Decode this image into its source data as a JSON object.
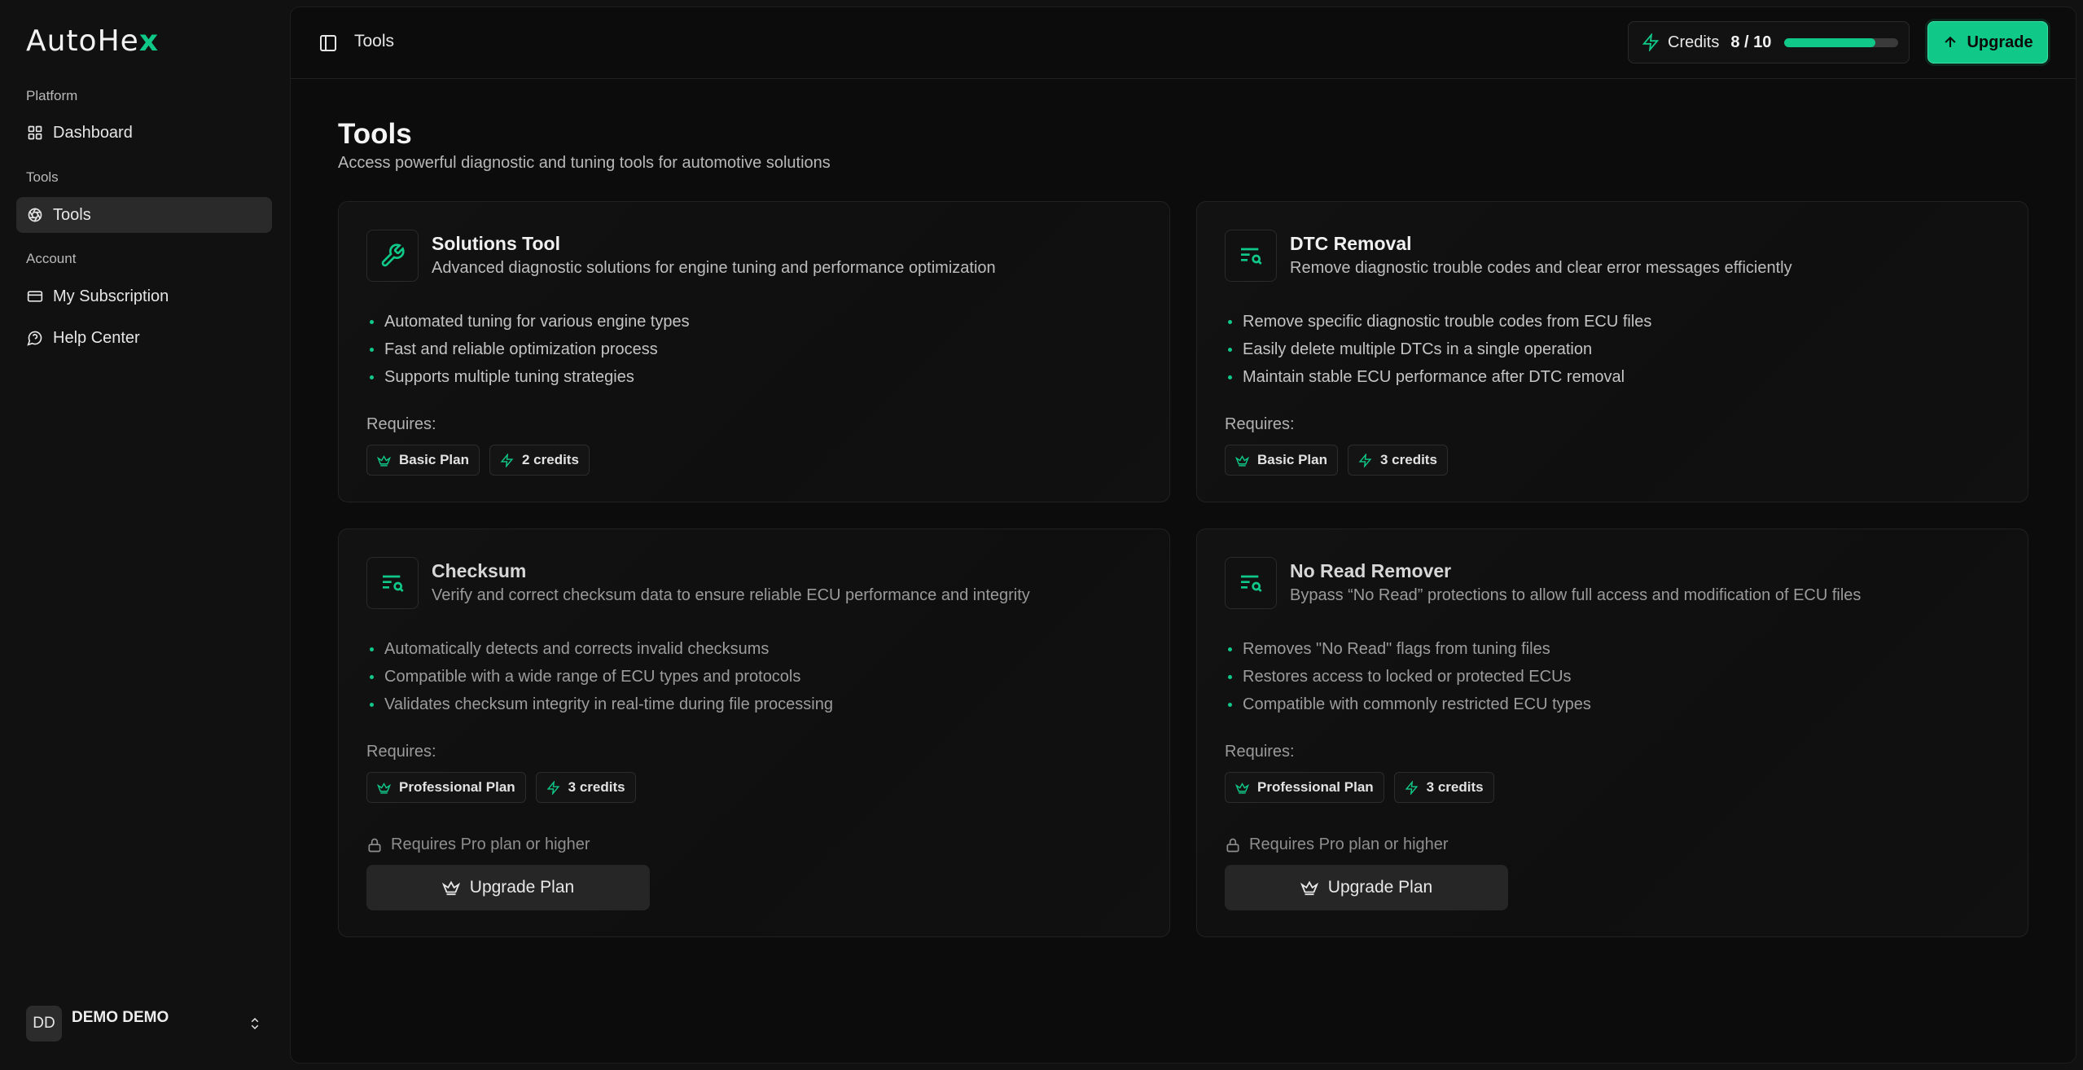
{
  "brand": {
    "name_main": "AutoHe",
    "name_accent": "x",
    "accent_color": "#10c988"
  },
  "sidebar": {
    "sections": [
      {
        "label": "Platform",
        "items": [
          {
            "label": "Dashboard",
            "icon": "grid-icon"
          }
        ]
      },
      {
        "label": "Tools",
        "items": [
          {
            "label": "Tools",
            "icon": "aperture-icon",
            "active": true
          }
        ]
      },
      {
        "label": "Account",
        "items": [
          {
            "label": "My Subscription",
            "icon": "credit-card-icon"
          },
          {
            "label": "Help Center",
            "icon": "help-chat-icon"
          }
        ]
      }
    ],
    "user": {
      "initials": "DD",
      "name": "DEMO DEMO"
    }
  },
  "header": {
    "breadcrumb": "Tools",
    "credits": {
      "label": "Credits",
      "value": "8 / 10",
      "used": 8,
      "total": 10
    },
    "upgrade_label": "Upgrade"
  },
  "page": {
    "title": "Tools",
    "subtitle": "Access powerful diagnostic and tuning tools for automotive solutions",
    "requires_label": "Requires:",
    "locked_note": "Requires Pro plan or higher",
    "upgrade_plan_label": "Upgrade Plan"
  },
  "tools": [
    {
      "title": "Solutions Tool",
      "description": "Advanced diagnostic solutions for engine tuning and performance optimization",
      "icon": "wrench-icon",
      "features": [
        "Automated tuning for various engine types",
        "Fast and reliable optimization process",
        "Supports multiple tuning strategies"
      ],
      "plan": "Basic Plan",
      "credits": "2 credits",
      "locked": false
    },
    {
      "title": "DTC Removal",
      "description": "Remove diagnostic trouble codes and clear error messages efficiently",
      "icon": "list-search-icon",
      "features": [
        "Remove specific diagnostic trouble codes from ECU files",
        "Easily delete multiple DTCs in a single operation",
        "Maintain stable ECU performance after DTC removal"
      ],
      "plan": "Basic Plan",
      "credits": "3 credits",
      "locked": false
    },
    {
      "title": "Checksum",
      "description": "Verify and correct checksum data to ensure reliable ECU performance and integrity",
      "icon": "list-search-icon",
      "features": [
        "Automatically detects and corrects invalid checksums",
        "Compatible with a wide range of ECU types and protocols",
        "Validates checksum integrity in real-time during file processing"
      ],
      "plan": "Professional Plan",
      "credits": "3 credits",
      "locked": true
    },
    {
      "title": "No Read Remover",
      "description": "Bypass “No Read” protections to allow full access and modification of ECU files",
      "icon": "list-search-icon",
      "features": [
        "Removes \"No Read\" flags from tuning files",
        "Restores access to locked or protected ECUs",
        "Compatible with commonly restricted ECU types"
      ],
      "plan": "Professional Plan",
      "credits": "3 credits",
      "locked": true
    }
  ]
}
